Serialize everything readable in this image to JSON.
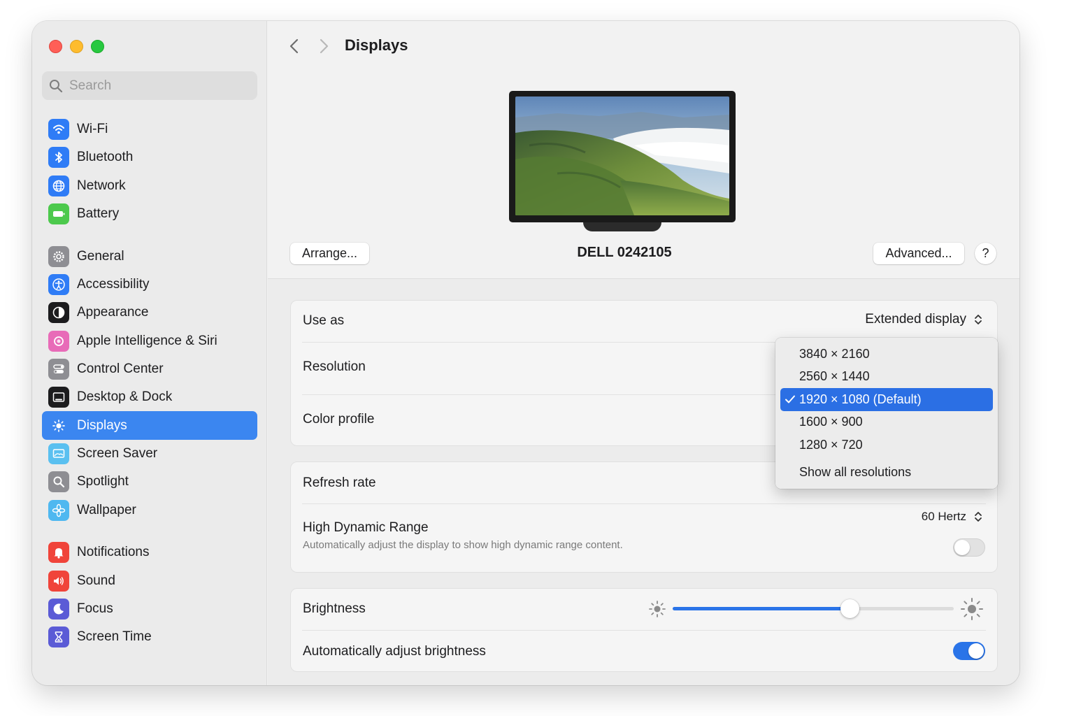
{
  "window": {
    "title": "Displays",
    "colors": {
      "accent": "#3b86f0",
      "toggle_on": "#2a74e8"
    }
  },
  "sidebar": {
    "search_placeholder": "Search",
    "groups": [
      [
        {
          "label": "Wi-Fi",
          "icon": "wifi-icon",
          "color": "#2f7cf6"
        },
        {
          "label": "Bluetooth",
          "icon": "bluetooth-icon",
          "color": "#2f7cf6"
        },
        {
          "label": "Network",
          "icon": "globe-icon",
          "color": "#2f7cf6"
        },
        {
          "label": "Battery",
          "icon": "battery-icon",
          "color": "#4cc94c"
        }
      ],
      [
        {
          "label": "General",
          "icon": "gear-icon",
          "color": "#8e8e93"
        },
        {
          "label": "Accessibility",
          "icon": "accessibility-icon",
          "color": "#2f7cf6"
        },
        {
          "label": "Appearance",
          "icon": "appearance-icon",
          "color": "#1c1c1e"
        },
        {
          "label": "Apple Intelligence & Siri",
          "icon": "siri-icon",
          "color": "#e86bb8"
        },
        {
          "label": "Control Center",
          "icon": "control-center-icon",
          "color": "#8e8e93"
        },
        {
          "label": "Desktop & Dock",
          "icon": "dock-icon",
          "color": "#1c1c1e"
        },
        {
          "label": "Displays",
          "icon": "sun-icon",
          "color": "#2f7cf6",
          "active": true
        },
        {
          "label": "Screen Saver",
          "icon": "screen-saver-icon",
          "color": "#5ac0f0"
        },
        {
          "label": "Spotlight",
          "icon": "magnifier-icon",
          "color": "#8e8e93"
        },
        {
          "label": "Wallpaper",
          "icon": "flower-icon",
          "color": "#4fb8f0"
        }
      ],
      [
        {
          "label": "Notifications",
          "icon": "bell-icon",
          "color": "#f0443a"
        },
        {
          "label": "Sound",
          "icon": "speaker-icon",
          "color": "#f0443a"
        },
        {
          "label": "Focus",
          "icon": "moon-icon",
          "color": "#5b5bd6"
        },
        {
          "label": "Screen Time",
          "icon": "hourglass-icon",
          "color": "#5b5bd6"
        }
      ]
    ]
  },
  "header": {
    "title": "Displays",
    "back_icon": "chevron-left-icon",
    "forward_icon": "chevron-right-icon"
  },
  "display": {
    "name": "DELL 0242105",
    "arrange_label": "Arrange...",
    "advanced_label": "Advanced...",
    "help_label": "?"
  },
  "settings": {
    "use_as": {
      "label": "Use as",
      "value": "Extended display"
    },
    "resolution": {
      "label": "Resolution"
    },
    "color_profile": {
      "label": "Color profile"
    },
    "refresh_rate": {
      "label": "Refresh rate",
      "value": "60 Hertz"
    },
    "hdr": {
      "label": "High Dynamic Range",
      "description": "Automatically adjust the display to show high dynamic range content.",
      "enabled": false
    },
    "brightness": {
      "label": "Brightness",
      "level": 0.63
    },
    "auto_brightness": {
      "label": "Automatically adjust brightness",
      "enabled": true
    }
  },
  "resolution_menu": {
    "options": [
      "3840 × 2160",
      "2560 × 1440",
      "1920 × 1080 (Default)",
      "1600 × 900",
      "1280 × 720"
    ],
    "selected_index": 2,
    "show_all_label": "Show all resolutions"
  }
}
